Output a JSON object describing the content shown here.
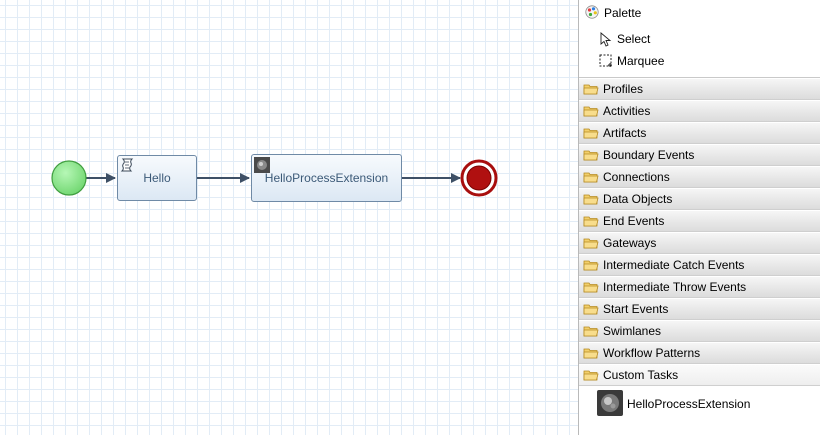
{
  "diagram": {
    "tasks": [
      {
        "label": "Hello",
        "icon": "script-icon"
      },
      {
        "label": "HelloProcessExtension",
        "icon": "custom-task-icon"
      }
    ],
    "start_event": {
      "color": "#7fe07f"
    },
    "end_event": {
      "color": "#b01010"
    }
  },
  "palette": {
    "title": "Palette",
    "tools": [
      {
        "label": "Select",
        "icon": "arrow-pointer-icon"
      },
      {
        "label": "Marquee",
        "icon": "marquee-icon"
      }
    ],
    "drawers": [
      {
        "label": "Profiles"
      },
      {
        "label": "Activities"
      },
      {
        "label": "Artifacts"
      },
      {
        "label": "Boundary Events"
      },
      {
        "label": "Connections"
      },
      {
        "label": "Data Objects"
      },
      {
        "label": "End Events"
      },
      {
        "label": "Gateways"
      },
      {
        "label": "Intermediate Catch Events"
      },
      {
        "label": "Intermediate Throw Events"
      },
      {
        "label": "Start Events"
      },
      {
        "label": "Swimlanes"
      },
      {
        "label": "Workflow Patterns"
      },
      {
        "label": "Custom Tasks"
      }
    ],
    "custom_tasks": [
      {
        "label": "HelloProcessExtension",
        "icon": "custom-task-icon"
      }
    ]
  }
}
